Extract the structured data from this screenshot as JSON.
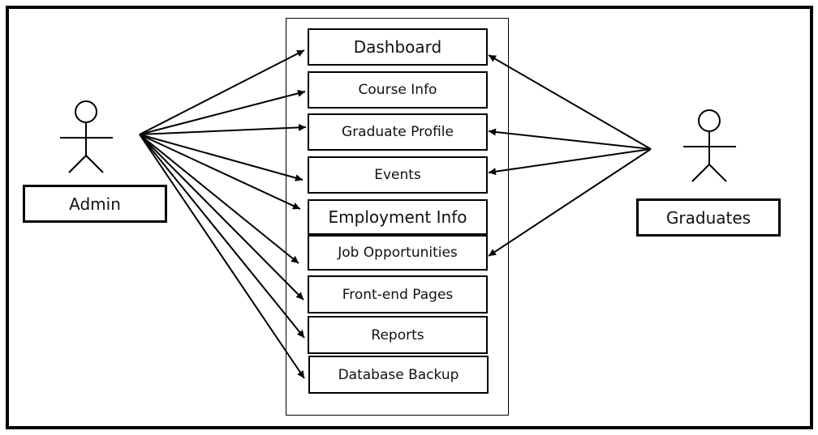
{
  "diagram": {
    "type": "use-case",
    "actors": [
      {
        "id": "admin",
        "label": "Admin"
      },
      {
        "id": "graduates",
        "label": "Graduates"
      }
    ],
    "use_cases": [
      {
        "id": "dashboard",
        "label": "Dashboard"
      },
      {
        "id": "course_info",
        "label": "Course Info"
      },
      {
        "id": "graduate_profile",
        "label": "Graduate Profile"
      },
      {
        "id": "events",
        "label": "Events"
      },
      {
        "id": "employment_info",
        "label": "Employment Info"
      },
      {
        "id": "job_opportunities",
        "label": "Job Opportunities"
      },
      {
        "id": "front_end_pages",
        "label": "Front-end Pages"
      },
      {
        "id": "reports",
        "label": "Reports"
      },
      {
        "id": "database_backup",
        "label": "Database Backup"
      }
    ],
    "associations": [
      {
        "from": "admin",
        "to": "dashboard"
      },
      {
        "from": "admin",
        "to": "course_info"
      },
      {
        "from": "admin",
        "to": "graduate_profile"
      },
      {
        "from": "admin",
        "to": "events"
      },
      {
        "from": "admin",
        "to": "employment_info"
      },
      {
        "from": "admin",
        "to": "job_opportunities"
      },
      {
        "from": "admin",
        "to": "front_end_pages"
      },
      {
        "from": "admin",
        "to": "reports"
      },
      {
        "from": "admin",
        "to": "database_backup"
      },
      {
        "from": "graduates",
        "to": "dashboard"
      },
      {
        "from": "graduates",
        "to": "graduate_profile"
      },
      {
        "from": "graduates",
        "to": "events"
      },
      {
        "from": "graduates",
        "to": "job_opportunities"
      }
    ]
  }
}
